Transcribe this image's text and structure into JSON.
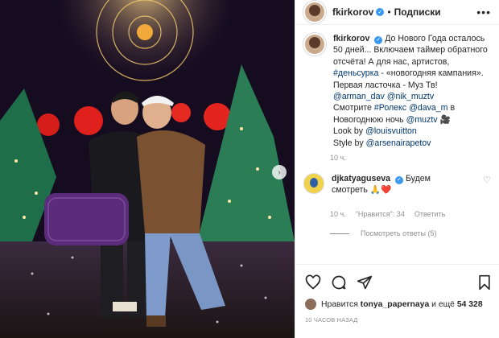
{
  "post": {
    "username": "fkirkorov",
    "verified_mark": "✓",
    "separator": "•",
    "follow_label": "Подписки",
    "more_label": "•••"
  },
  "caption": {
    "username": "fkirkorov",
    "text_1": "До Нового Года осталось 50 дней... Включаем таймер обратного отсчёта! А для нас, артистов, ",
    "tag_1": "#деньсурка",
    "text_2": " - «новогодняя кампания». Первая ласточка - Муз Тв! ",
    "mention_1": "@arman_dav",
    "mention_2": "@nik_muztv",
    "text_3": "Смотрите ",
    "tag_2": "#Ролекс",
    "mention_3": "@dava_m",
    "text_4": " в Новогоднюю ночь ",
    "mention_4": "@muztv",
    "emoji_1": "🎥",
    "text_5": "Look by ",
    "mention_5": "@louisvuitton",
    "text_6": "Style by ",
    "mention_6": "@arsenairapetov",
    "time": "10 ч."
  },
  "comment": {
    "username": "djkatyaguseva",
    "text": "Будем смотреть",
    "emoji": "🙏❤️",
    "time": "10 ч.",
    "likes": "\"Нравится\": 34",
    "reply_label": "Ответить",
    "view_replies": "Посмотреть ответы (5)"
  },
  "footer": {
    "liked_prefix": "Нравится",
    "liked_user": "tonya_papernaya",
    "liked_mid": "и ещё",
    "liked_count": "54 328",
    "ago": "10 ЧАСОВ НАЗАД"
  },
  "media": {
    "next_arrow": "›"
  }
}
